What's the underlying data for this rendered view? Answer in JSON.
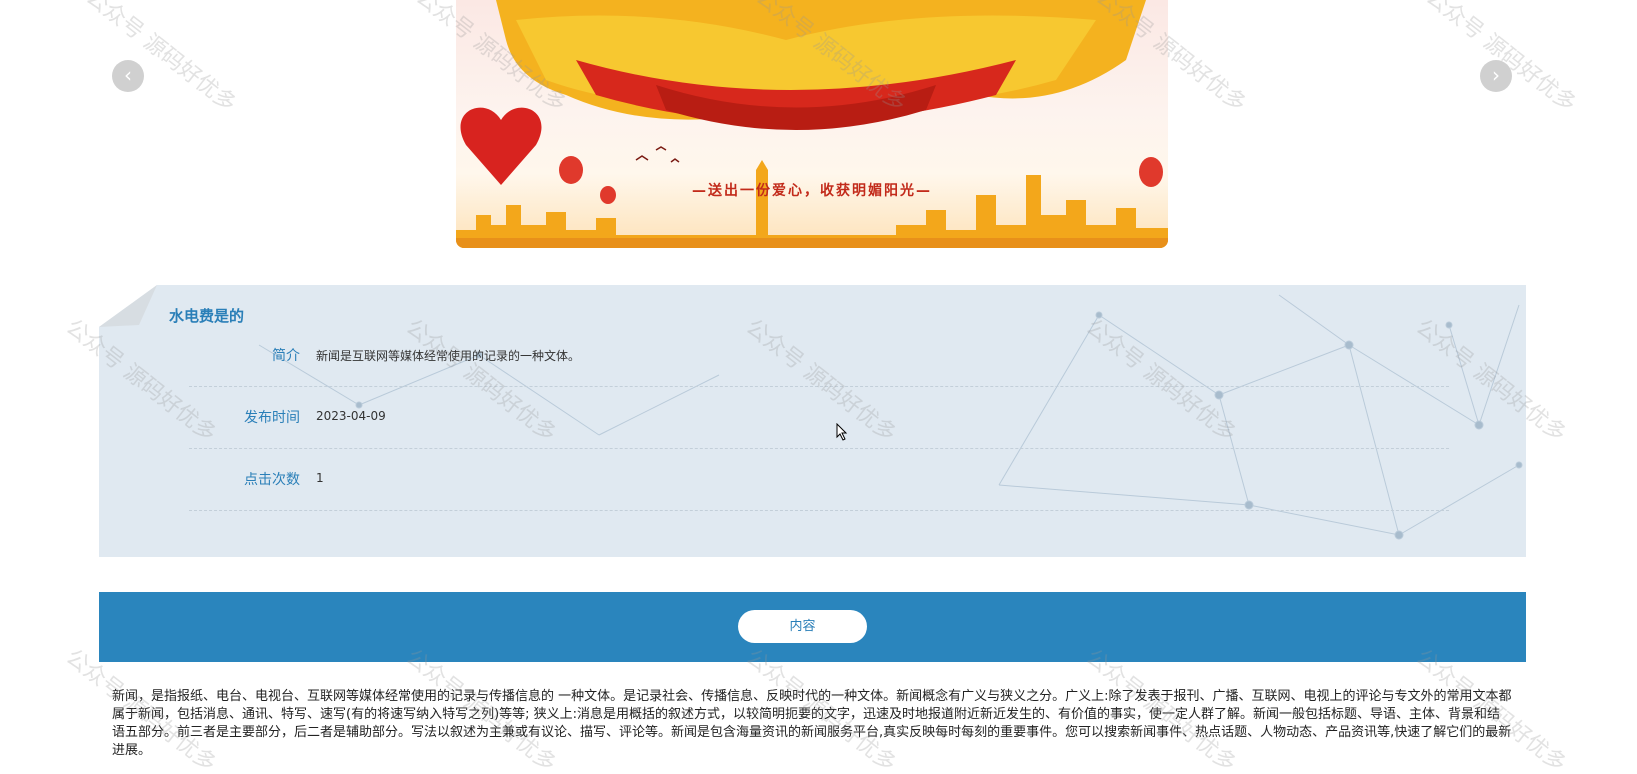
{
  "carousel": {
    "prev_icon": "chevron-left-icon",
    "next_icon": "chevron-right-icon",
    "prev_glyph": "‹",
    "next_glyph": "›",
    "banner_slogan": "—送出一份爱心，收获明媚阳光—"
  },
  "detail": {
    "title": "水电费是的",
    "fields": [
      {
        "label": "简介",
        "value": "新闻是互联网等媒体经常使用的记录的一种文体。"
      },
      {
        "label": "发布时间",
        "value": "2023-04-09"
      },
      {
        "label": "点击次数",
        "value": "1"
      }
    ]
  },
  "content_tab": {
    "label": "内容"
  },
  "body_text": "新闻，是指报纸、电台、电视台、互联网等媒体经常使用的记录与传播信息的 一种文体。是记录社会、传播信息、反映时代的一种文体。新闻概念有广义与狭义之分。广义上:除了发表于报刊、广播、互联网、电视上的评论与专文外的常用文本都属于新闻，包括消息、通讯、特写、速写(有的将速写纳入特写之列)等等; 狭义上:消息是用概括的叙述方式，以较简明扼要的文字，迅速及时地报道附近新近发生的、有价值的事实，使一定人群了解。新闻一般包括标题、导语、主体、背景和结语五部分。前三者是主要部分，后二者是辅助部分。写法以叙述为主兼或有议论、描写、评论等。新闻是包含海量资讯的新闻服务平台,真实反映每时每刻的重要事件。您可以搜索新闻事件、热点话题、人物动态、产品资讯等,快速了解它们的最新进展。",
  "watermark": "公众号 源码好优多",
  "colors": {
    "accent": "#2a85bd",
    "label": "#2a7fb8",
    "panel_bg": "#e0e9f1"
  }
}
